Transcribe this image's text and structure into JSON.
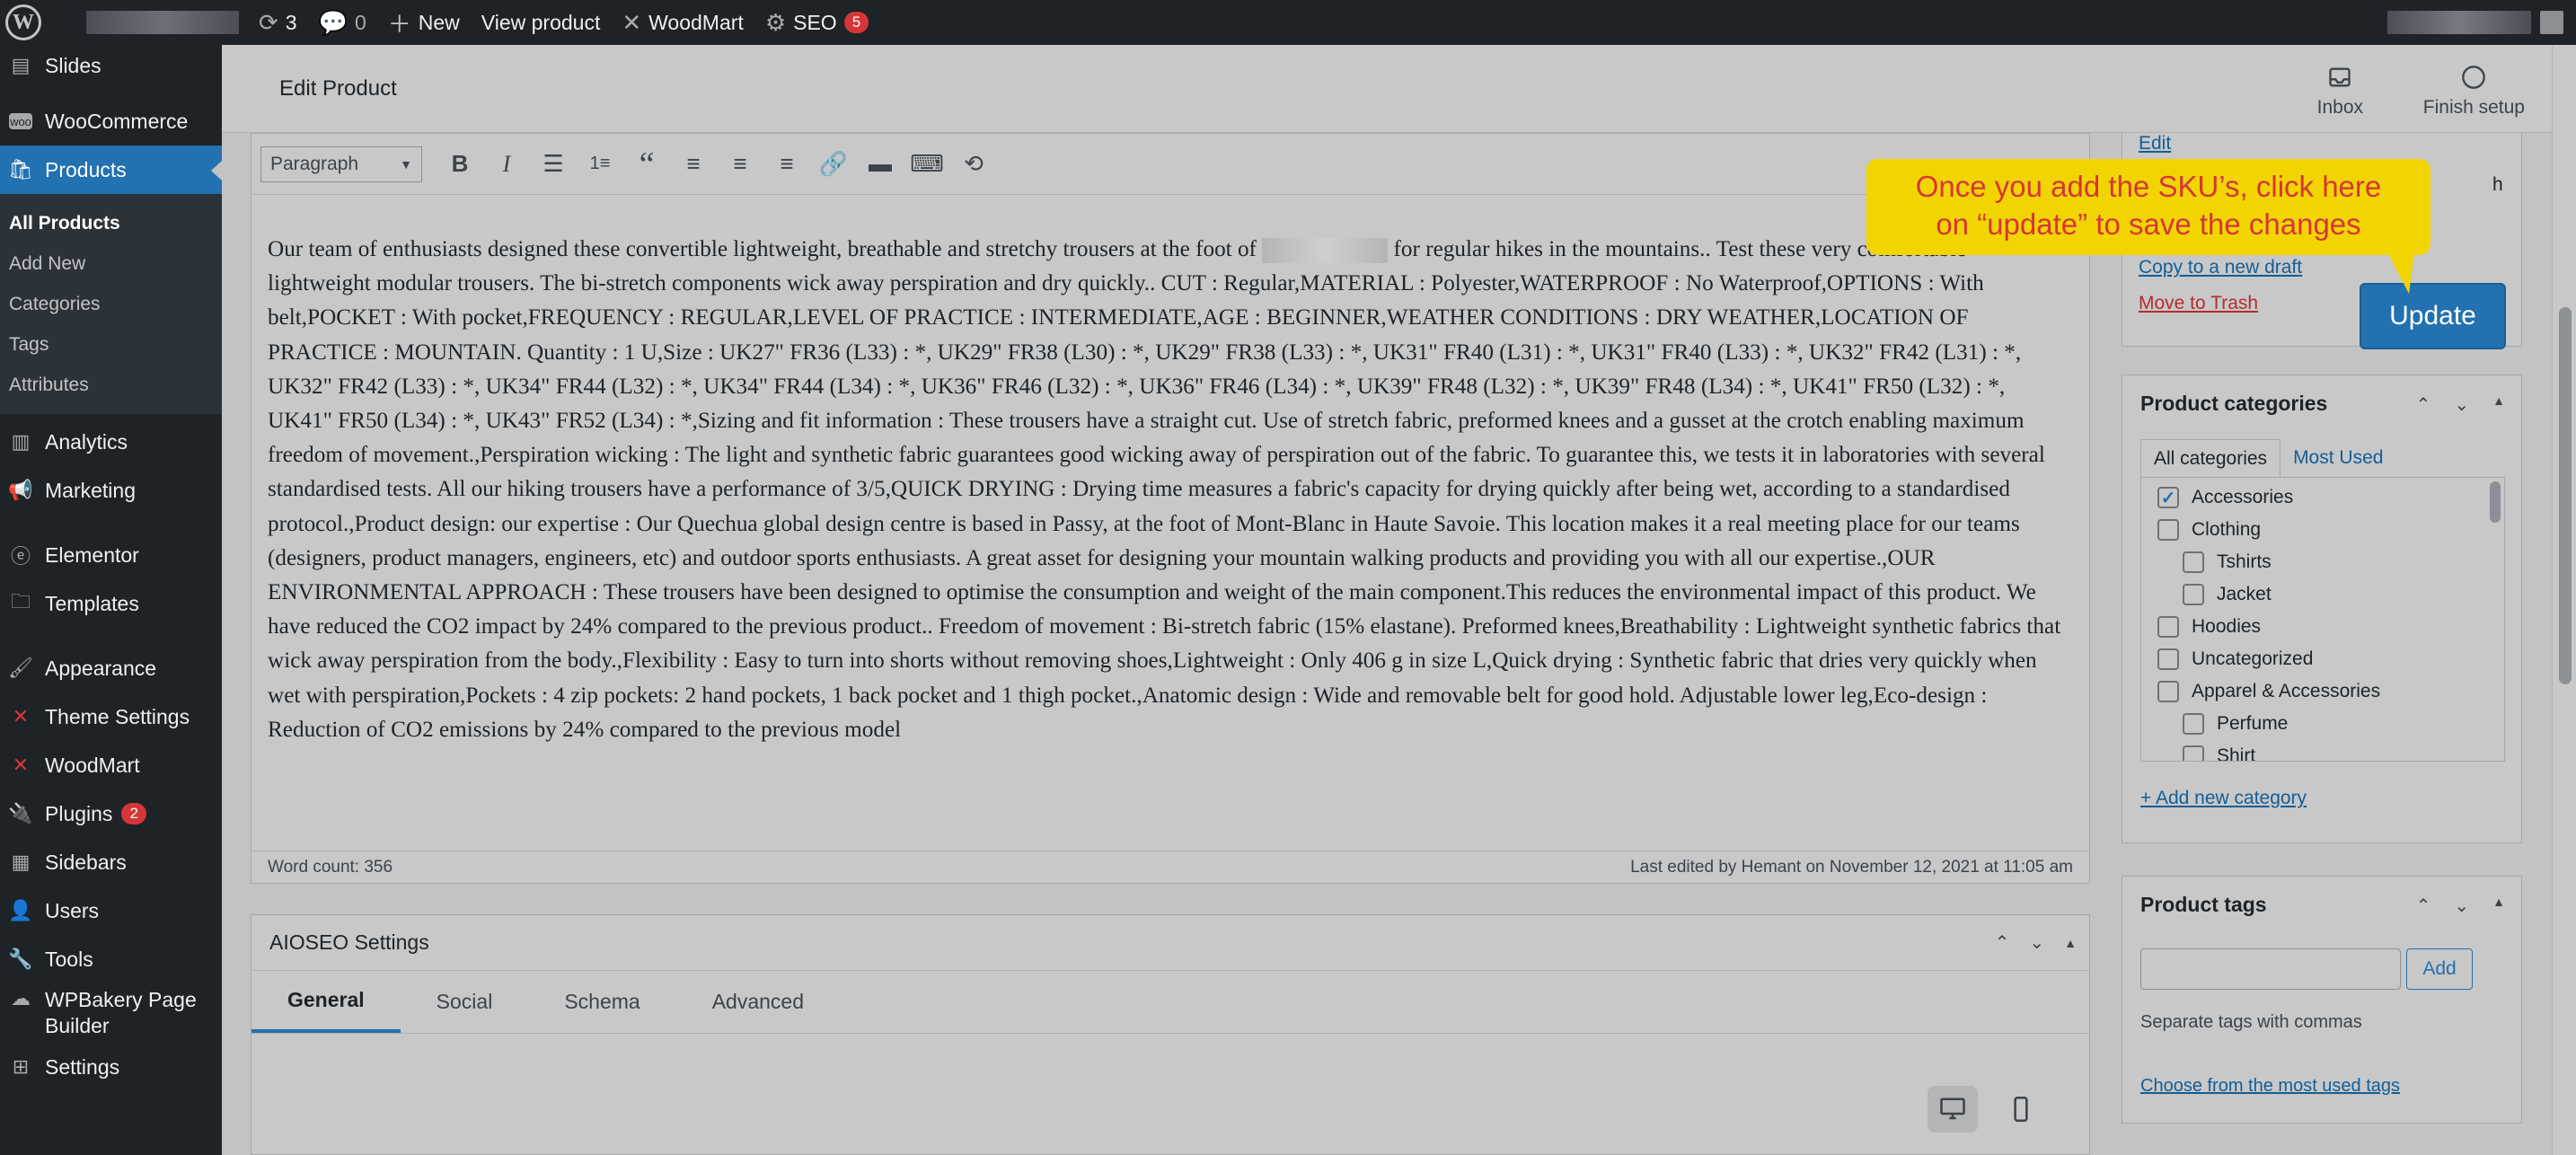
{
  "adminbar": {
    "updates_count": "3",
    "comments_count": "0",
    "new_label": "New",
    "view_product": "View product",
    "woodmart": "WoodMart",
    "seo": "SEO",
    "seo_badge": "5"
  },
  "sidebar": {
    "items": [
      {
        "label": "Slides",
        "icon": "slides-icon"
      },
      {
        "label": "WooCommerce",
        "icon": "woocommerce-icon"
      },
      {
        "label": "Products",
        "icon": "products-icon"
      },
      {
        "label": "Analytics",
        "icon": "analytics-icon"
      },
      {
        "label": "Marketing",
        "icon": "megaphone-icon"
      },
      {
        "label": "Elementor",
        "icon": "elementor-icon"
      },
      {
        "label": "Templates",
        "icon": "folder-icon"
      },
      {
        "label": "Appearance",
        "icon": "brush-icon"
      },
      {
        "label": "Theme Settings",
        "icon": "woodmart-icon"
      },
      {
        "label": "WoodMart",
        "icon": "woodmart-icon"
      },
      {
        "label": "Plugins",
        "icon": "plugin-icon",
        "badge": "2"
      },
      {
        "label": "Sidebars",
        "icon": "sidebars-icon"
      },
      {
        "label": "Users",
        "icon": "user-icon"
      },
      {
        "label": "Tools",
        "icon": "wrench-icon"
      },
      {
        "label": "WPBakery Page",
        "label2": "Builder",
        "icon": "wpbakery-icon"
      },
      {
        "label": "Settings",
        "icon": "settings-icon"
      }
    ],
    "submenu": [
      "All Products",
      "Add New",
      "Categories",
      "Tags",
      "Attributes"
    ]
  },
  "header": {
    "title": "Edit Product",
    "inbox": "Inbox",
    "finish_setup": "Finish setup"
  },
  "editor": {
    "format": "Paragraph",
    "content_before_blur": "Our team of enthusiasts designed these convertible lightweight, breathable and stretchy trousers at the foot of",
    "content_after_blur": " for regular hikes in the mountains.. Test these very comfortable lightweight modular trousers. The bi-stretch components wick away perspiration and dry quickly.. CUT : Regular,MATERIAL : Polyester,WATERPROOF : No Waterproof,OPTIONS : With belt,POCKET : With pocket,FREQUENCY : REGULAR,LEVEL OF PRACTICE : INTERMEDIATE,AGE : BEGINNER,WEATHER CONDITIONS : DRY WEATHER,LOCATION OF PRACTICE : MOUNTAIN. Quantity : 1 U,Size : UK27\" FR36 (L33) : *, UK29\" FR38 (L30) : *, UK29\" FR38 (L33) : *, UK31\" FR40 (L31) : *, UK31\" FR40 (L33) : *, UK32\" FR42 (L31) : *, UK32\" FR42 (L33) : *, UK34\" FR44 (L32) : *, UK34\" FR44 (L34) : *, UK36\" FR46 (L32) : *, UK36\" FR46 (L34) : *, UK39\" FR48 (L32) : *, UK39\" FR48 (L34) : *, UK41\" FR50 (L32) : *, UK41\" FR50 (L34) : *, UK43\" FR52 (L34) : *,Sizing and fit information : These trousers have a straight cut. Use of stretch fabric, preformed knees and a gusset at the crotch enabling maximum freedom of movement.,Perspiration wicking : The light and synthetic fabric guarantees good wicking away of perspiration out of the fabric. To guarantee this, we tests it in laboratories with several standardised tests. All our hiking trousers have a performance of 3/5,QUICK DRYING : Drying time measures a fabric's capacity for drying quickly after being wet, according to a standardised protocol.,Product design: our expertise : Our Quechua global design centre is based in Passy, at the foot of Mont-Blanc in Haute Savoie. This location makes it a real meeting place for our teams (designers, product managers, engineers, etc) and outdoor sports enthusiasts. A great asset for designing your mountain walking products and providing you with all our expertise.,OUR ENVIRONMENTAL APPROACH : These trousers have been designed to optimise the consumption and weight of the main component.This reduces the environmental impact of this product. We have reduced the CO2 impact by 24% compared to the previous product.. Freedom of movement : Bi-stretch fabric (15% elastane). Preformed knees,Breathability : Lightweight synthetic fabrics that wick away perspiration from the body.,Flexibility : Easy to turn into shorts without removing shoes,Lightweight : Only 406 g in size L,Quick drying : Synthetic fabric that dries very quickly when wet with perspiration,Pockets : 4 zip pockets: 2 hand pockets, 1 back pocket and 1 thigh pocket.,Anatomic design : Wide and removable belt for good hold. Adjustable lower leg,Eco-design : Reduction of CO2 emissions by 24% compared to the previous model",
    "word_count": "Word count: 356",
    "last_edited": "Last edited by Hemant on November 12, 2021 at 11:05 am"
  },
  "aioseo": {
    "title": "AIOSEO Settings",
    "tabs": [
      "General",
      "Social",
      "Schema",
      "Advanced"
    ]
  },
  "publish": {
    "edit": "Edit",
    "copy_draft": "Copy to a new draft",
    "trash": "Move to Trash",
    "update": "Update",
    "partial": "h"
  },
  "callout": {
    "line1": "Once you add the SKU’s, click here",
    "line2": "on “update” to save the changes",
    "color": "#f2d500"
  },
  "categories": {
    "title": "Product categories",
    "tab_all": "All categories",
    "tab_used": "Most Used",
    "items": [
      {
        "label": "Accessories",
        "checked": "✓",
        "indent": 0
      },
      {
        "label": "Clothing",
        "checked": "",
        "indent": 0
      },
      {
        "label": "Tshirts",
        "checked": "",
        "indent": 1
      },
      {
        "label": "Jacket",
        "checked": "",
        "indent": 1
      },
      {
        "label": "Hoodies",
        "checked": "",
        "indent": 0
      },
      {
        "label": "Uncategorized",
        "checked": "",
        "indent": 0
      },
      {
        "label": "Apparel & Accessories",
        "checked": "",
        "indent": 0
      },
      {
        "label": "Perfume",
        "checked": "",
        "indent": 1
      },
      {
        "label": "Shirt",
        "checked": "",
        "indent": 1
      }
    ],
    "add_new": "+ Add new category"
  },
  "tags": {
    "title": "Product tags",
    "add": "Add",
    "input_value": "",
    "help": "Separate tags with commas",
    "choose": "Choose from the most used tags"
  }
}
